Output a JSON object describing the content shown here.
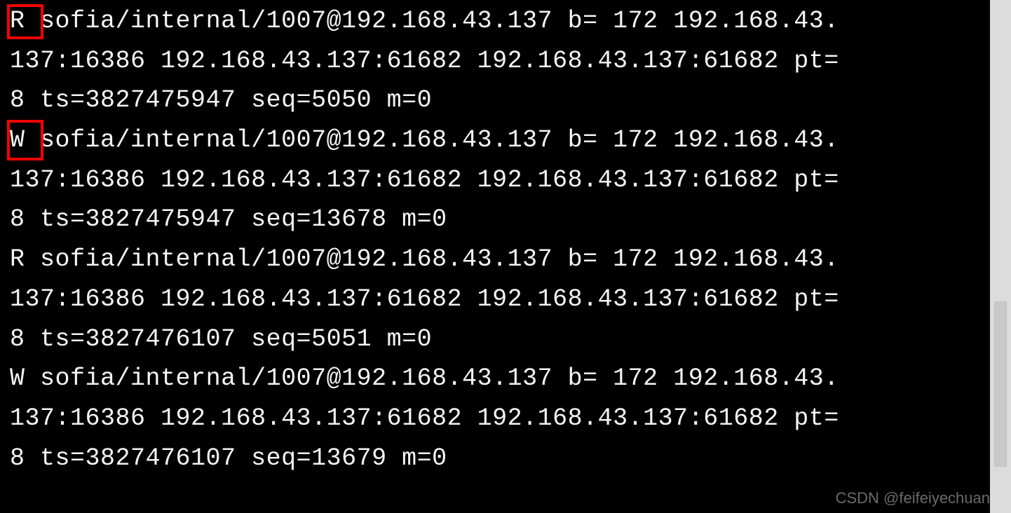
{
  "colors": {
    "terminal_bg": "#000000",
    "terminal_fg": "#f5f5f5",
    "highlight_border": "#ff0000",
    "page_bg": "#d8d8d8",
    "scroll_thumb": "#c9c9c9",
    "watermark": "#8e8e8e"
  },
  "highlights": [
    {
      "label": "R"
    },
    {
      "label": "W"
    }
  ],
  "terminal": {
    "entries": [
      {
        "direction": "R",
        "endpoint": "sofia/internal/1007@192.168.43.137",
        "b": 172,
        "addr1": "192.168.43.137:16386",
        "addr2": "192.168.43.137:61682",
        "addr3": "192.168.43.137:61682",
        "pt": 8,
        "ts": 3827475947,
        "seq": 5050,
        "m": 0
      },
      {
        "direction": "W",
        "endpoint": "sofia/internal/1007@192.168.43.137",
        "b": 172,
        "addr1": "192.168.43.137:16386",
        "addr2": "192.168.43.137:61682",
        "addr3": "192.168.43.137:61682",
        "pt": 8,
        "ts": 3827475947,
        "seq": 13678,
        "m": 0
      },
      {
        "direction": "R",
        "endpoint": "sofia/internal/1007@192.168.43.137",
        "b": 172,
        "addr1": "192.168.43.137:16386",
        "addr2": "192.168.43.137:61682",
        "addr3": "192.168.43.137:61682",
        "pt": 8,
        "ts": 3827476107,
        "seq": 5051,
        "m": 0
      },
      {
        "direction": "W",
        "endpoint": "sofia/internal/1007@192.168.43.137",
        "b": 172,
        "addr1": "192.168.43.137:16386",
        "addr2": "192.168.43.137:61682",
        "addr3": "192.168.43.137:61682",
        "pt": 8,
        "ts": 3827476107,
        "seq": 13679,
        "m": 0
      }
    ]
  },
  "watermark": "CSDN @feifeiyechuan"
}
